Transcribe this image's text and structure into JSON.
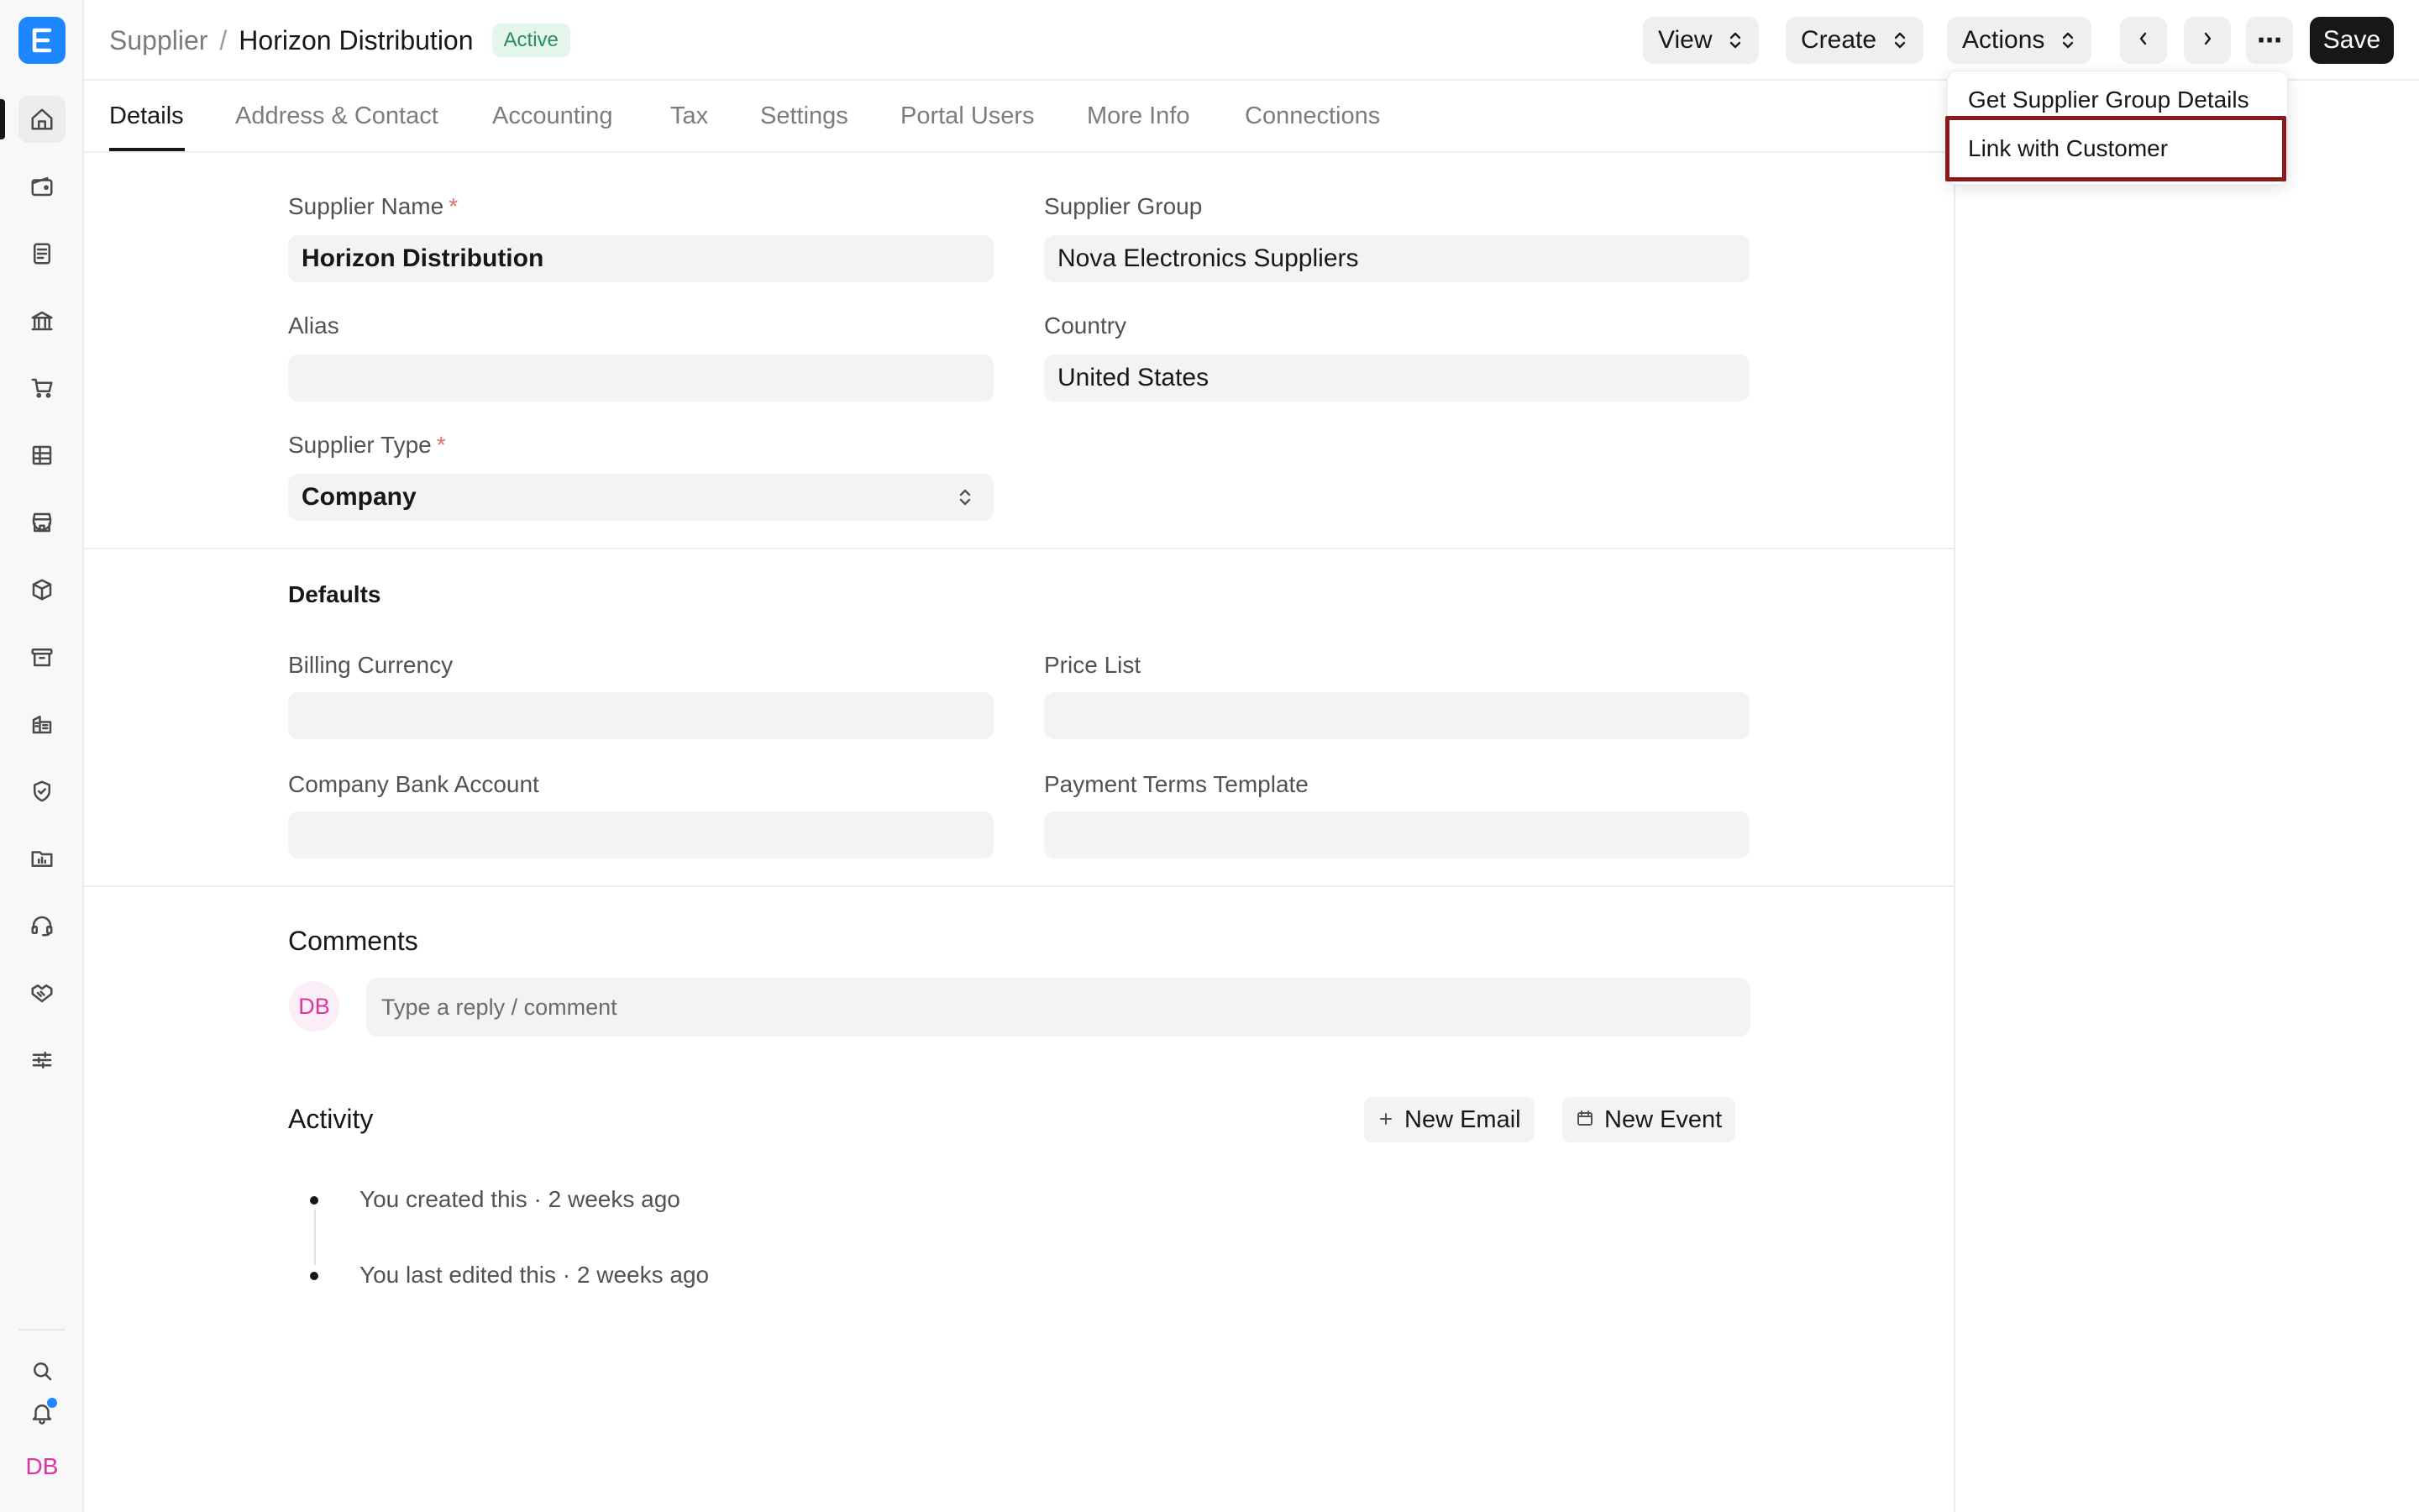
{
  "header": {
    "breadcrumb_parent": "Supplier",
    "breadcrumb_sep": "/",
    "title": "Horizon Distribution",
    "status": "Active",
    "view_label": "View",
    "create_label": "Create",
    "actions_label": "Actions",
    "more_label": "⋯",
    "save_label": "Save"
  },
  "tabs": [
    "Details",
    "Address & Contact",
    "Accounting",
    "Tax",
    "Settings",
    "Portal Users",
    "More Info",
    "Connections"
  ],
  "form": {
    "supplier_name_label": "Supplier Name",
    "supplier_name_value": "Horizon Distribution",
    "supplier_group_label": "Supplier Group",
    "supplier_group_value": "Nova Electronics Suppliers",
    "alias_label": "Alias",
    "alias_value": "",
    "country_label": "Country",
    "country_value": "United States",
    "supplier_type_label": "Supplier Type",
    "supplier_type_value": "Company",
    "required_mark": "*"
  },
  "defaults": {
    "section_title": "Defaults",
    "billing_currency_label": "Billing Currency",
    "price_list_label": "Price List",
    "company_bank_account_label": "Company Bank Account",
    "payment_terms_template_label": "Payment Terms Template"
  },
  "comments": {
    "title": "Comments",
    "avatar_initials": "DB",
    "placeholder": "Type a reply / comment"
  },
  "activity": {
    "title": "Activity",
    "new_email_label": "New Email",
    "new_event_label": "New Event",
    "items": [
      "You created this · 2 weeks ago",
      "You last edited this · 2 weeks ago"
    ]
  },
  "actions_menu": {
    "items": [
      "Get Supplier Group Details",
      "Link with Customer"
    ],
    "highlighted": "Link with Customer"
  },
  "sidebar": {
    "user_initials": "DB",
    "icons": [
      "home-icon",
      "wallet-icon",
      "document-icon",
      "bank-icon",
      "cart-icon",
      "table-icon",
      "store-icon",
      "box-icon",
      "archive-icon",
      "building-icon",
      "shield-icon",
      "folder-chart-icon",
      "headset-icon",
      "handshake-icon",
      "sliders-icon",
      "search-icon",
      "bell-icon"
    ]
  },
  "colors": {
    "brand": "#1e86ff",
    "highlight_border": "#8b1a1a",
    "status_green": "#278f5e",
    "avatar_pink": "#e0339f"
  }
}
